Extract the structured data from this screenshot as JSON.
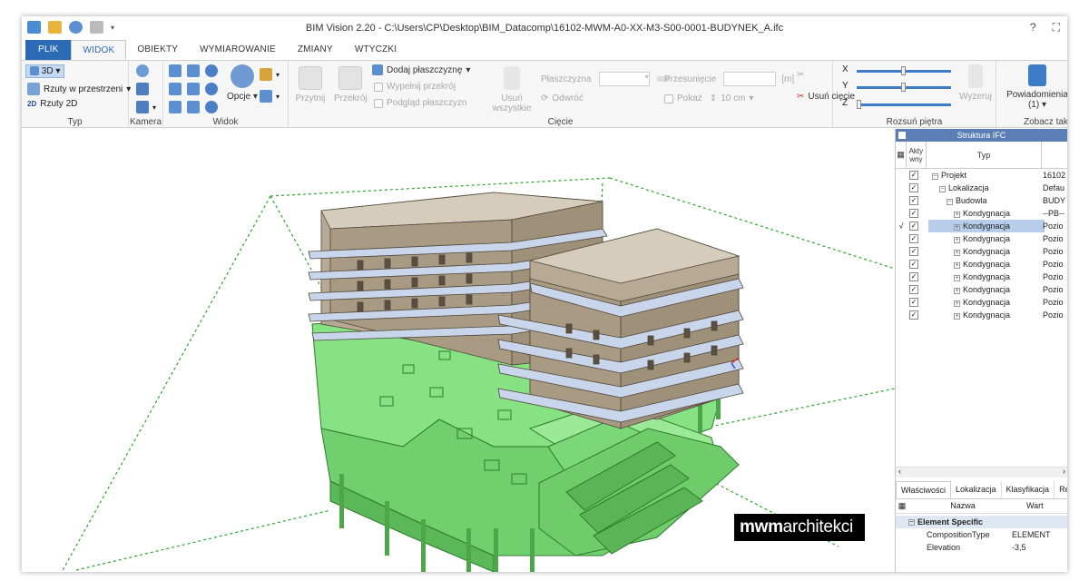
{
  "window": {
    "title": "BIM Vision 2.20 - C:\\Users\\CP\\Desktop\\BIM_Datacomp\\16102-MWM-A0-XX-M3-S00-0001-BUDYNEK_A.ifc",
    "help": "?",
    "restore": "⛶"
  },
  "tabs": [
    "PLIK",
    "WIDOK",
    "OBIEKTY",
    "WYMIAROWANIE",
    "ZMIANY",
    "WTYCZKI"
  ],
  "ribbon": {
    "typ": {
      "label": "Typ",
      "mode_3d": "3D",
      "rzuty_przestrzeni": "Rzuty w przestrzeni",
      "rzuty_2d": "Rzuty 2D",
      "icon_2d": "2D"
    },
    "kamera": {
      "label": "Kamera"
    },
    "widok": {
      "label": "Widok",
      "opcje": "Opcje"
    },
    "ciecie": {
      "label": "Cięcie",
      "przytnij": "Przytnij",
      "przekroj": "Przekrój",
      "dodaj": "Dodaj płaszczyznę",
      "wypelnij": "Wypełnij przekrój",
      "podglad": "Podgląd płaszczyzn",
      "usun_wszystkie_1": "Usuń",
      "usun_wszystkie_2": "wszystkie",
      "plaszczyzna": "Płaszczyzna",
      "odwroc": "Odwróć",
      "przesuniecie": "Przesunięcie",
      "unit": "[m]",
      "pokaz": "Pokaż",
      "cm": "10 cm",
      "usun_ciecie": "Usuń cięcie"
    },
    "rozsun": {
      "label": "Rozsuń piętra",
      "x": "X",
      "y": "Y",
      "z": "Z",
      "wyzeruj": "Wyzeruj"
    },
    "zobacz": {
      "label": "Zobacz tak",
      "powiadomienia": "Powiadomienia",
      "count": "(1)"
    }
  },
  "panel": {
    "title": "Struktura IFC",
    "col_active": "Akty wny",
    "col_type": "Typ",
    "rows": [
      {
        "name": "Projekt",
        "value": "16102",
        "indent": 0,
        "mark": ""
      },
      {
        "name": "Lokalizacja",
        "value": "Defau",
        "indent": 1,
        "mark": ""
      },
      {
        "name": "Budowla",
        "value": "BUDY",
        "indent": 2,
        "mark": ""
      },
      {
        "name": "Kondygnacja",
        "value": "--PB--",
        "indent": 3,
        "mark": ""
      },
      {
        "name": "Kondygnacja",
        "value": "Pozio",
        "indent": 3,
        "mark": "√"
      },
      {
        "name": "Kondygnacja",
        "value": "Pozio",
        "indent": 3,
        "mark": ""
      },
      {
        "name": "Kondygnacja",
        "value": "Pozio",
        "indent": 3,
        "mark": ""
      },
      {
        "name": "Kondygnacja",
        "value": "Pozio",
        "indent": 3,
        "mark": ""
      },
      {
        "name": "Kondygnacja",
        "value": "Pozio",
        "indent": 3,
        "mark": ""
      },
      {
        "name": "Kondygnacja",
        "value": "Pozio",
        "indent": 3,
        "mark": ""
      },
      {
        "name": "Kondygnacja",
        "value": "Pozio",
        "indent": 3,
        "mark": ""
      },
      {
        "name": "Kondygnacja",
        "value": "Pozio",
        "indent": 3,
        "mark": ""
      }
    ],
    "prop_tabs": [
      "Właściwości",
      "Lokalizacja",
      "Klasyfikacja",
      "Re"
    ],
    "prop_col_name": "Nazwa",
    "prop_col_value": "Wart",
    "prop_group": "Element Specific",
    "props": [
      {
        "name": "CompositionType",
        "value": "ELEMENT"
      },
      {
        "name": "Elevation",
        "value": "-3,5"
      }
    ]
  },
  "logo": {
    "bold": "mwm",
    "light": "architekci"
  },
  "colors": {
    "accent": "#2b6ab5",
    "selection": "#b7cde9",
    "model_green": "#7ee07c",
    "building_tan": "#b7a993",
    "slab_blue": "#c9d5ea"
  }
}
